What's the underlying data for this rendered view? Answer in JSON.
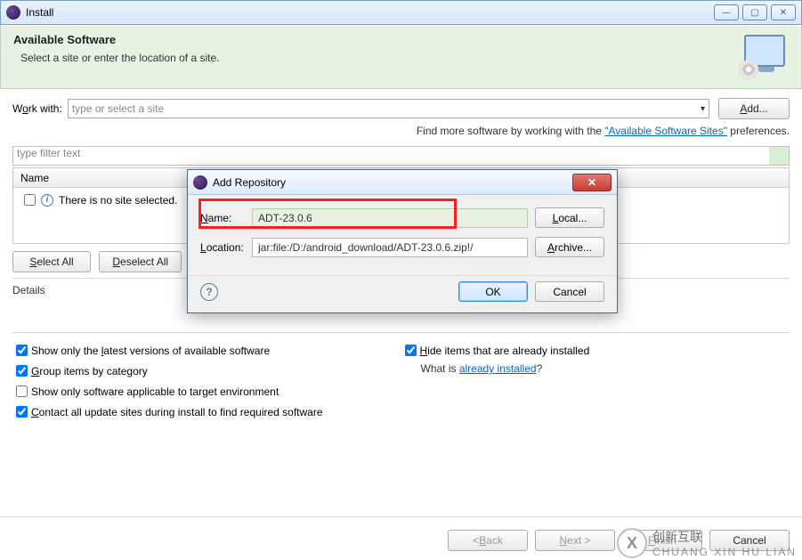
{
  "window": {
    "title": "Install"
  },
  "banner": {
    "heading": "Available Software",
    "subtext": "Select a site or enter the location of a site."
  },
  "workWith": {
    "label_pre": "W",
    "label_u": "o",
    "label_post": "rk with:",
    "placeholder": "type or select a site",
    "add_pre": "",
    "add_u": "A",
    "add_post": "dd..."
  },
  "hint": {
    "pre": "Find more software by working with the ",
    "link": "\"Available Software Sites\"",
    "post": " preferences."
  },
  "filter": {
    "placeholder": "type filter text"
  },
  "table": {
    "header": "Name",
    "empty_msg": "There is no site selected."
  },
  "buttons": {
    "select_all_u": "S",
    "select_all_post": "elect All",
    "deselect_all_u": "D",
    "deselect_all_post": "eselect All"
  },
  "details_label": "Details",
  "checks": {
    "c1_pre": "Show only the ",
    "c1_u": "l",
    "c1_post": "atest versions of available software",
    "c2_u": "H",
    "c2_post": "ide items that are already installed",
    "c3_u": "G",
    "c3_post": "roup items by category",
    "c4": "Show only software applicable to target environment",
    "c5_u": "C",
    "c5_post": "ontact all update sites during install to find required software",
    "whatis_pre": "What is ",
    "whatis_link": "already installed",
    "whatis_post": "?"
  },
  "wizard": {
    "back_pre": "< ",
    "back_u": "B",
    "back_post": "ack",
    "next_u": "N",
    "next_post": "ext >",
    "finish_u": "F",
    "finish_post": "inish",
    "cancel": "Cancel"
  },
  "dialog": {
    "title": "Add Repository",
    "name_label_u": "N",
    "name_label_post": "ame:",
    "name_value": "ADT-23.0.6",
    "local_u": "L",
    "local_post": "ocal...",
    "loc_label_u": "L",
    "loc_label_post": "ocation:",
    "loc_value": "jar:file:/D:/android_download/ADT-23.0.6.zip!/",
    "archive_u": "A",
    "archive_post": "rchive...",
    "ok": "OK",
    "cancel": "Cancel"
  },
  "watermark": {
    "brand": "创新互联",
    "sub": "CHUANG XIN HU LIAN"
  }
}
